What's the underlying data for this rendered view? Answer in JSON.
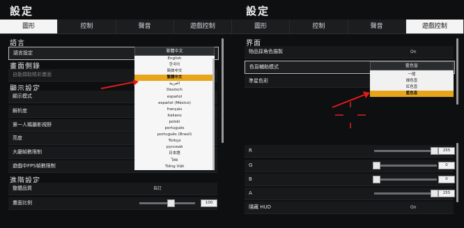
{
  "left": {
    "title": "設定",
    "tabs": [
      "圖形",
      "控制",
      "聲音",
      "遊戲控制"
    ],
    "active_tab": 0,
    "sections": {
      "language": "語言",
      "screen_capture": "畫面側錄",
      "display": "顯示設定",
      "advanced": "進階設定"
    },
    "rows": {
      "language_setting": "語言設定",
      "language_value": "繁體中文",
      "auto_record": "自動擷取精彩畫面",
      "display_mode": "顯示模式",
      "resolution": "解析度",
      "fpp_fov": "第一人稱攝影視野",
      "brightness": "亮度",
      "lobby_fps": "大廳幀數限制",
      "ingame_fps": "遊戲中FPS幀數限制",
      "quality": "整體品質",
      "quality_value": "自訂",
      "screen_scale": "畫面比例",
      "screen_scale_value": "100"
    },
    "languages": [
      "English",
      "한국어",
      "简体中文",
      "繁體中文",
      "العربية",
      "Deutsch",
      "español",
      "español (México)",
      "français",
      "italiano",
      "polski",
      "português",
      "português (Brasil)",
      "Türkçe",
      "русский",
      "日本語",
      "ไทย",
      "Tiếng Việt"
    ],
    "selected_language_index": 3,
    "screen_scale_level": 0.56
  },
  "right": {
    "title": "設定",
    "tabs": [
      "圖形",
      "控制",
      "聲音",
      "遊戲控制"
    ],
    "active_tab": 3,
    "sections": {
      "interface": "界面"
    },
    "rows": {
      "item_outline": "物品採角色描製",
      "item_outline_value": "On",
      "colorblind_mode": "色盲輔助模式",
      "colorblind_value": "藍色盲",
      "crosshair_color": "準星色彩",
      "r": "R",
      "r_value": "255",
      "g": "G",
      "g_value": "0",
      "b": "B",
      "b_value": "0",
      "a": "A",
      "a_value": "255",
      "hide_hud": "隱藏 HUD",
      "hide_hud_value": "On"
    },
    "colorblind_options": [
      "一般",
      "綠色盲",
      "紅色盲",
      "藍色盲"
    ],
    "selected_colorblind_index": 3,
    "crosshair_hex": "#e02020",
    "accent": "#e7a51b"
  }
}
